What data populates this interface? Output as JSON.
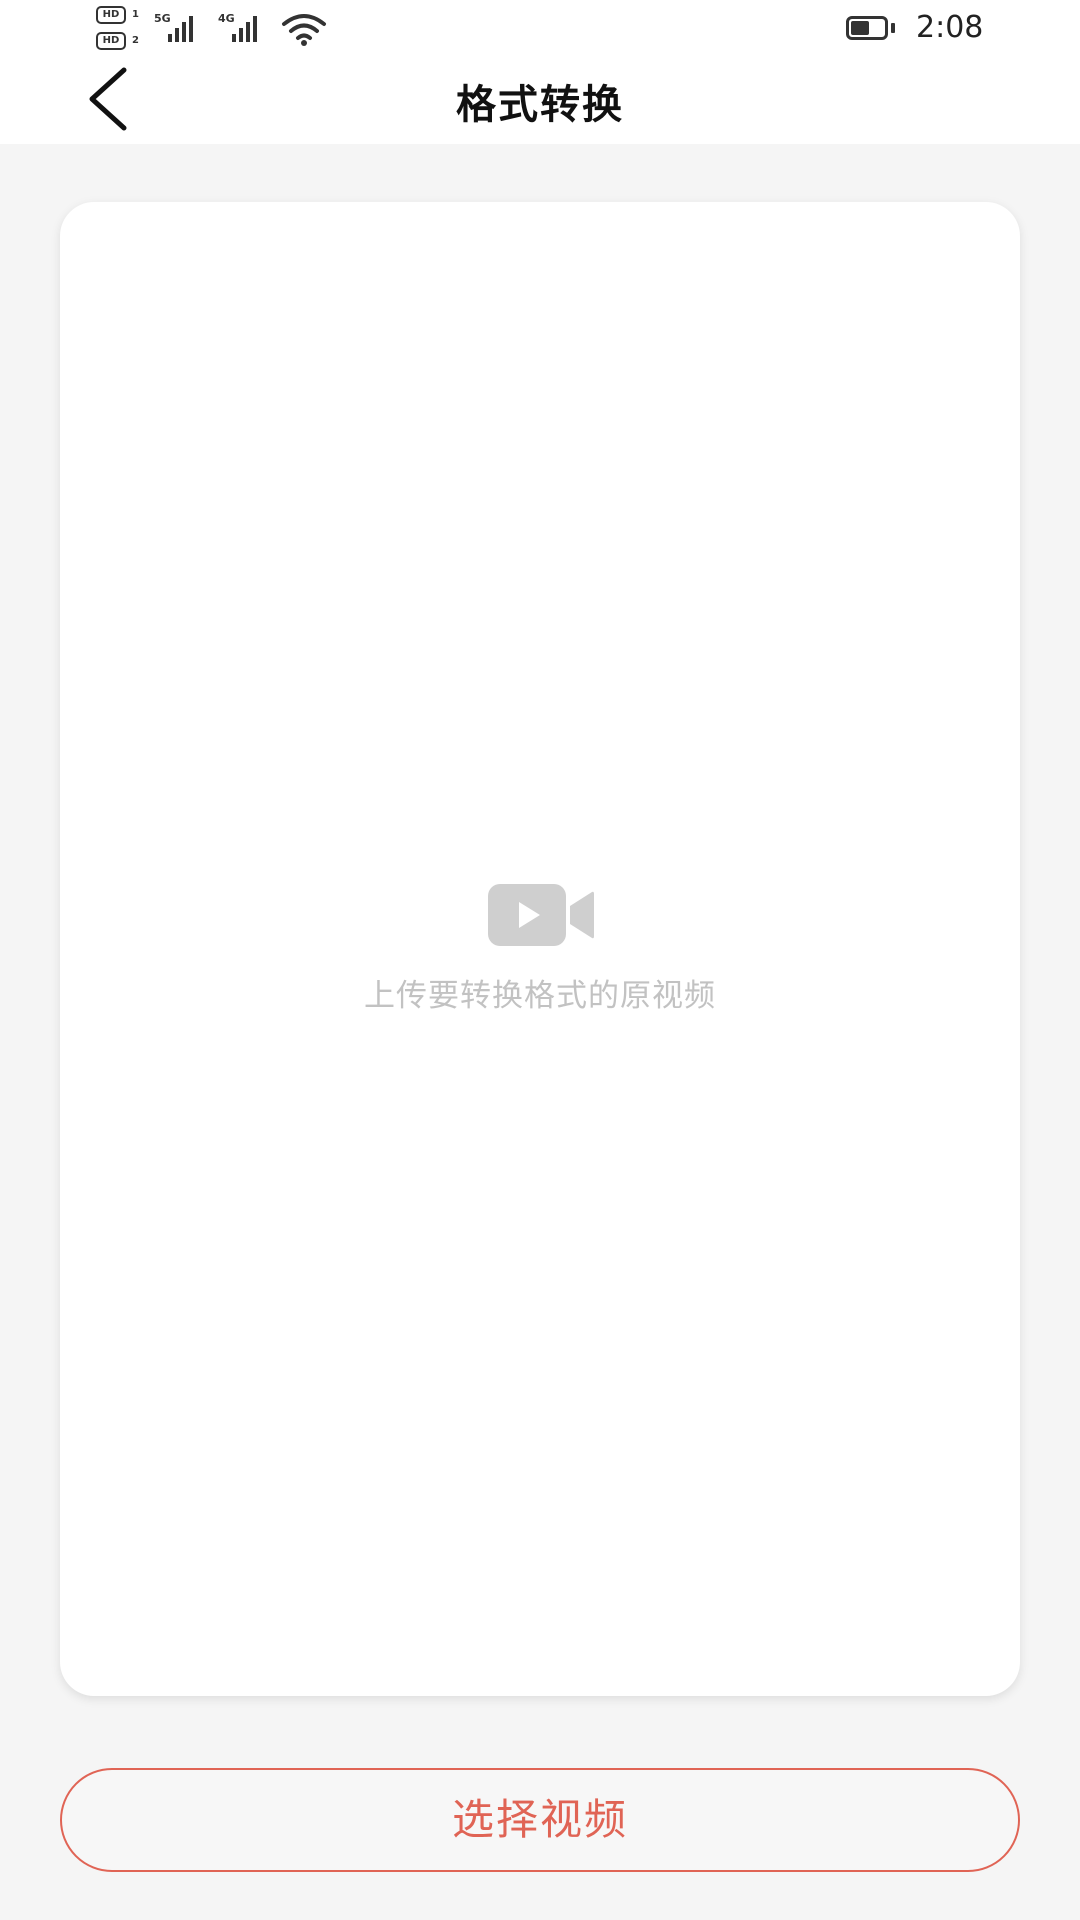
{
  "status_bar": {
    "hd1": "HD",
    "hd1_sub": "1",
    "hd2": "HD",
    "hd2_sub": "2",
    "signal1_tag": "5G",
    "signal2_tag": "4G",
    "time": "2:08",
    "battery_level": 0.45,
    "icons": [
      "hd-icon",
      "signal-icon",
      "wifi-icon",
      "battery-icon"
    ]
  },
  "nav": {
    "title": "格式转换",
    "back_icon": "chevron-left-icon"
  },
  "upload_area": {
    "icon": "video-camera-icon",
    "hint": "上传要转换格式的原视频"
  },
  "actions": {
    "select_video_label": "选择视频"
  },
  "colors": {
    "accent": "#e06455",
    "background": "#f5f5f5",
    "card": "#ffffff",
    "hint_text": "#c2c2c2"
  }
}
